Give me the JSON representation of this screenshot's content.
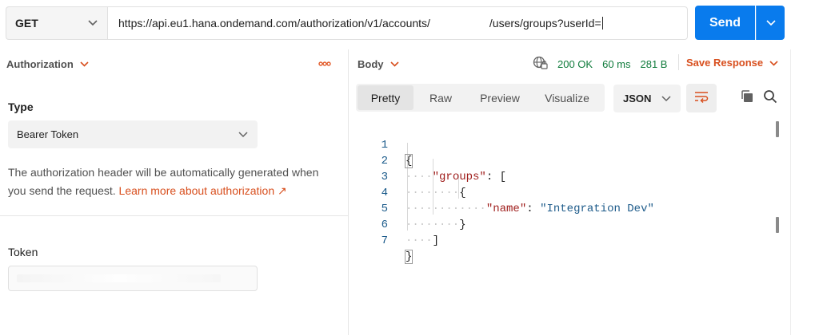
{
  "request": {
    "method": "GET",
    "url_part1": "https://api.eu1.hana.ondemand.com/authorization/v1/accounts/",
    "url_part2": "/users/groups?userId=",
    "send_label": "Send"
  },
  "auth": {
    "section_title": "Authorization",
    "type_label": "Type",
    "type_value": "Bearer Token",
    "description": "The authorization header will be automatically generated when you send the request. ",
    "learn_more": "Learn more about authorization ↗",
    "token_label": "Token"
  },
  "response": {
    "section_title": "Body",
    "status": "200 OK",
    "time": "60 ms",
    "size": "281 B",
    "save_label": "Save Response",
    "tabs": [
      "Pretty",
      "Raw",
      "Preview",
      "Visualize"
    ],
    "active_tab": "Pretty",
    "format": "JSON"
  },
  "code": {
    "line_numbers": [
      "1",
      "2",
      "3",
      "4",
      "5",
      "6",
      "7"
    ],
    "tokens": {
      "open_brace": "{",
      "groups_key": "\"groups\"",
      "colon_bracket": ": [",
      "inner_open": "{",
      "name_key": "\"name\"",
      "colon": ": ",
      "name_value": "\"Integration Dev\"",
      "inner_close": "}",
      "close_bracket": "]",
      "close_brace": "}"
    }
  },
  "colors": {
    "accent": "#097bed",
    "orange": "#d84f1e",
    "success": "#0f7b3b"
  },
  "icons": [
    "chevron-down-icon",
    "more-horizontal-icon",
    "globe-lock-icon",
    "wrap-lines-icon",
    "copy-icon",
    "search-icon"
  ]
}
